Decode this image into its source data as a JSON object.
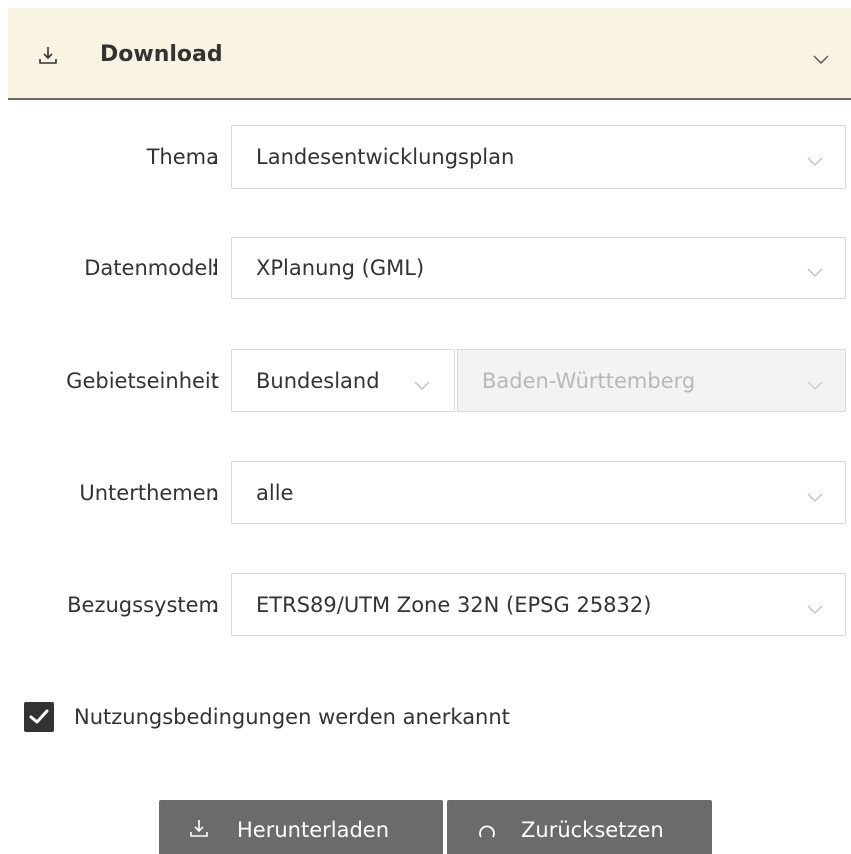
{
  "header": {
    "title": "Download",
    "download_icon": "download-icon",
    "toggle_icon": "chevron-down-icon"
  },
  "form": {
    "colon": ":",
    "thema": {
      "label": "Thema",
      "value": "Landesentwicklungsplan"
    },
    "datenmodell": {
      "label": "Datenmodell",
      "value": "XPlanung (GML)"
    },
    "gebietseinheit": {
      "label": "Gebietseinheit",
      "type_value": "Bundesland",
      "region_value": "Baden-Württemberg"
    },
    "unterthemen": {
      "label": "Unterthemen",
      "value": "alle"
    },
    "bezugssystem": {
      "label": "Bezugssystem",
      "value": "ETRS89/UTM Zone 32N (EPSG 25832)"
    }
  },
  "terms": {
    "checked": true,
    "label": "Nutzungsbedingungen werden anerkannt"
  },
  "buttons": {
    "download_label": "Herunterladen",
    "reset_label": "Zurücksetzen"
  },
  "colors": {
    "header_bg": "#f8f4e1",
    "button_bg": "#6b6b6b",
    "checkbox_bg": "#333333",
    "disabled_bg": "#f3f3f3"
  }
}
